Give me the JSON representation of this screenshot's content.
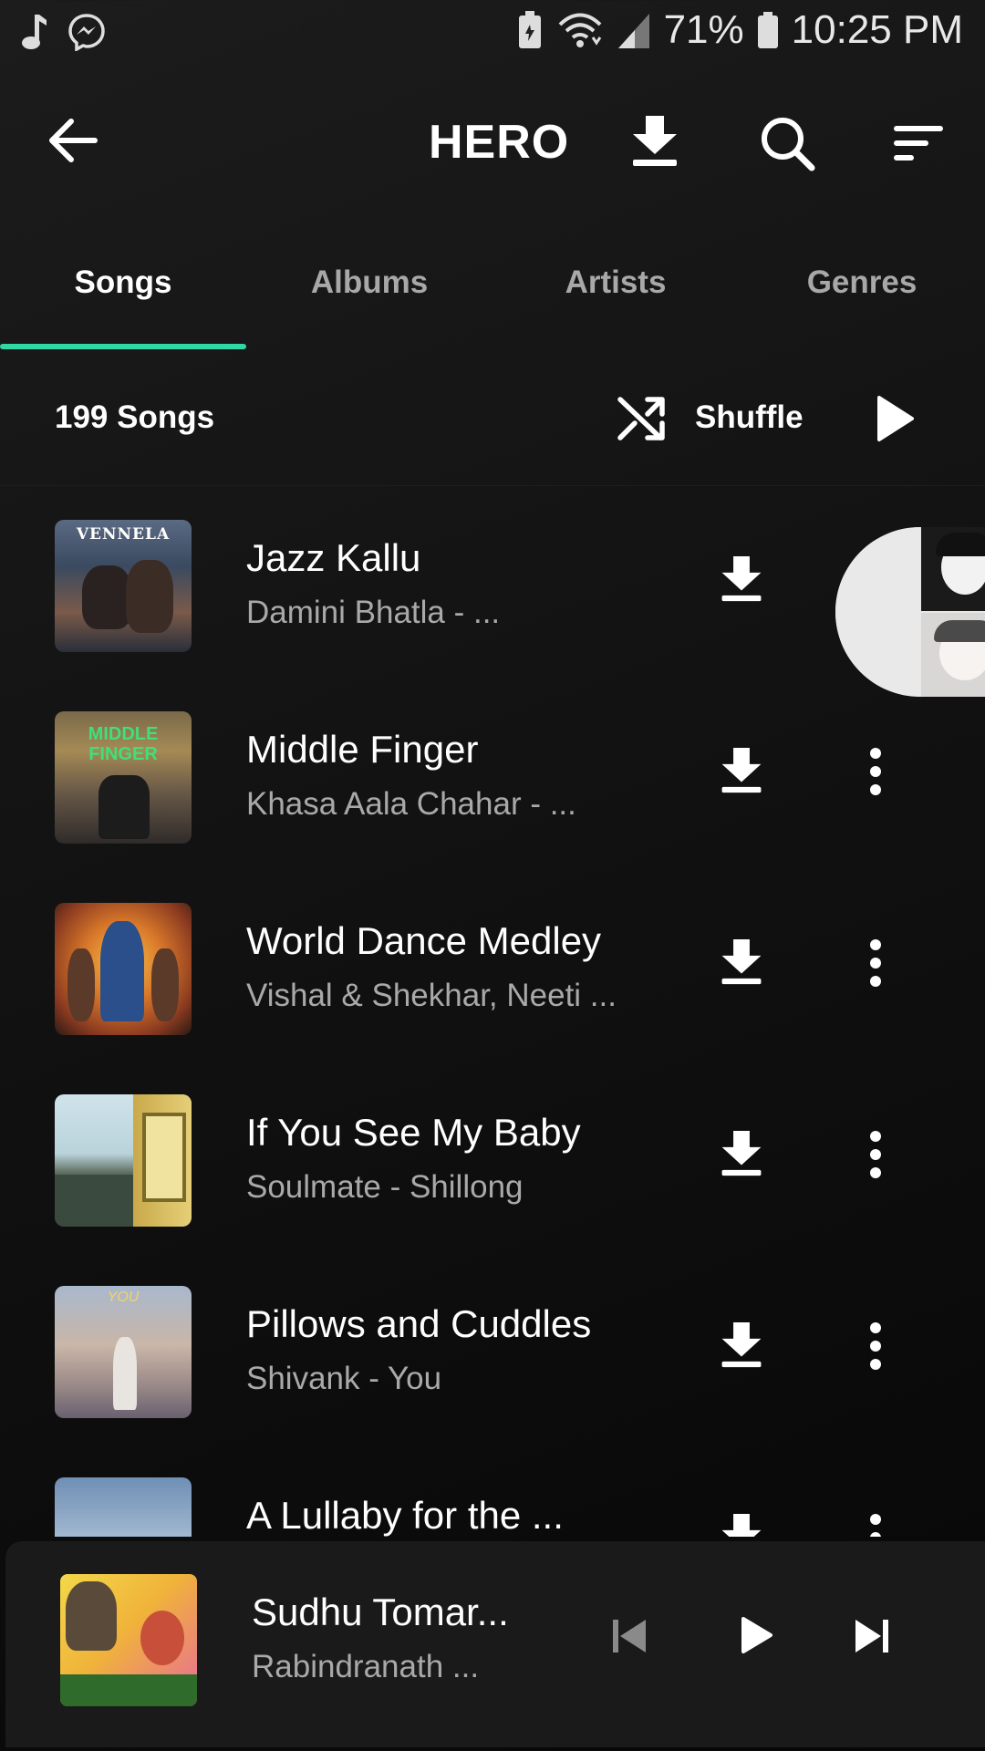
{
  "status_bar": {
    "battery": "71%",
    "time": "10:25 PM",
    "icons": [
      "music-note-icon",
      "messenger-icon",
      "battery-saver-icon",
      "wifi-icon",
      "signal-icon",
      "battery-icon"
    ]
  },
  "app_bar": {
    "title": "HERO",
    "icons": [
      "back-arrow-icon",
      "download-icon",
      "search-icon",
      "sort-icon"
    ]
  },
  "tabs": [
    {
      "label": "Songs",
      "active": true
    },
    {
      "label": "Albums",
      "active": false
    },
    {
      "label": "Artists",
      "active": false
    },
    {
      "label": "Genres",
      "active": false
    }
  ],
  "accent_color": "#2fd8a4",
  "header": {
    "count": "199 Songs",
    "shuffle_label": "Shuffle"
  },
  "songs": [
    {
      "title": "Jazz Kallu",
      "subtitle": "Damini Bhatla - ...",
      "art_text": "VENNELA"
    },
    {
      "title": "Middle Finger",
      "subtitle": "Khasa Aala Chahar - ...",
      "art_text": "MIDDLE FINGER"
    },
    {
      "title": "World Dance Medley",
      "subtitle": "Vishal & Shekhar, Neeti ...",
      "art_text": ""
    },
    {
      "title": "If You See My Baby",
      "subtitle": "Soulmate - Shillong",
      "art_text": ""
    },
    {
      "title": "Pillows and Cuddles",
      "subtitle": "Shivank - You",
      "art_text": "YOU"
    },
    {
      "title": "A Lullaby for the ...",
      "subtitle": "",
      "art_text": ""
    }
  ],
  "now_playing": {
    "title": "Sudhu Tomar...",
    "subtitle": "Rabindranath ..."
  }
}
